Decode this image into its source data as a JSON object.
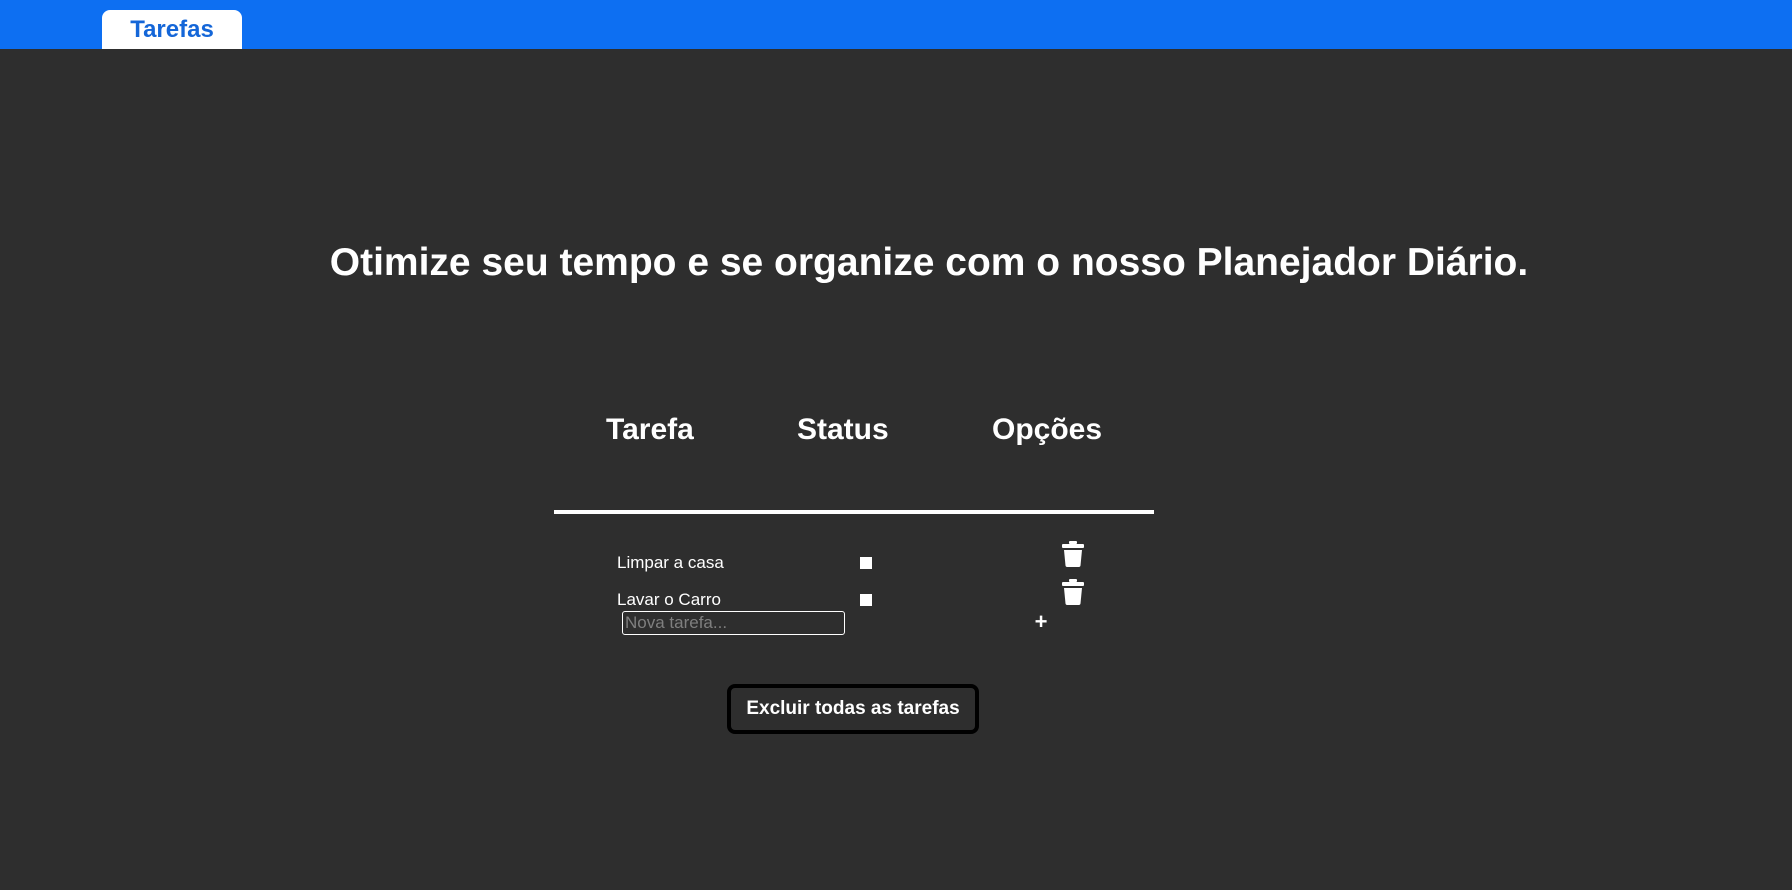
{
  "nav": {
    "tab_label": "Tarefas"
  },
  "headline": "Otimize seu tempo e se organize com o nosso Planejador Diário.",
  "table": {
    "columns": [
      "Tarefa",
      "Status",
      "Opções"
    ],
    "tasks": [
      {
        "label": "Limpar a casa",
        "icon": "trash-icon"
      },
      {
        "label": "Lavar o Carro",
        "icon": "trash-icon"
      }
    ]
  },
  "new_task": {
    "placeholder": "Nova tarefa...",
    "add_label": "+"
  },
  "clear_all_label": "Excluir todas as tarefas",
  "colors": {
    "topbar": "#0d6ff2",
    "tab_text": "#1466d8",
    "background": "#2e2e2e",
    "text": "#ffffff"
  }
}
